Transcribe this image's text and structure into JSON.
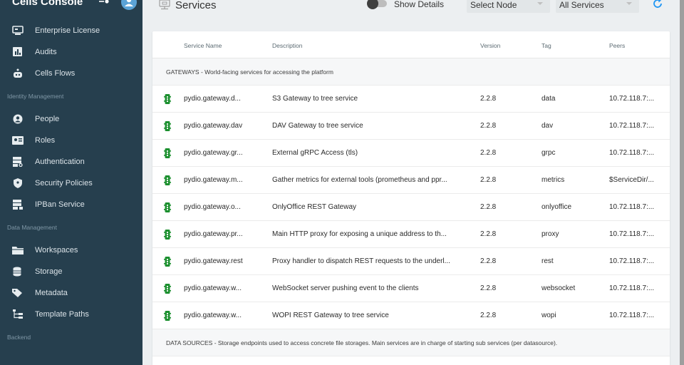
{
  "app": {
    "title": "Cells Console"
  },
  "colors": {
    "sidebar_bg": "#263f4e",
    "accent": "#5ba3d6",
    "status_ok": "#1b8f2e"
  },
  "sidebar": {
    "items_top": [
      {
        "label": "Enterprise License",
        "icon": "license-icon"
      },
      {
        "label": "Audits",
        "icon": "chart-icon"
      },
      {
        "label": "Cells Flows",
        "icon": "robot-icon"
      }
    ],
    "section_identity": "Identity Management",
    "items_identity": [
      {
        "label": "People",
        "icon": "person-icon"
      },
      {
        "label": "Roles",
        "icon": "id-card-icon"
      },
      {
        "label": "Authentication",
        "icon": "server-key-icon"
      },
      {
        "label": "Security Policies",
        "icon": "shield-icon"
      },
      {
        "label": "IPBan Service",
        "icon": "server-lock-icon"
      }
    ],
    "section_data": "Data Management",
    "items_data": [
      {
        "label": "Workspaces",
        "icon": "folder-icon"
      },
      {
        "label": "Storage",
        "icon": "database-icon"
      },
      {
        "label": "Metadata",
        "icon": "tag-icon"
      },
      {
        "label": "Template Paths",
        "icon": "file-tree-icon"
      }
    ],
    "section_backend": "Backend"
  },
  "header": {
    "title": "Services",
    "show_details_label": "Show Details",
    "select_node": "Select Node",
    "select_services": "All Services"
  },
  "table": {
    "columns": [
      "Service Name",
      "Description",
      "Version",
      "Tag",
      "Peers"
    ],
    "group_gateways": "GATEWAYS - World-facing services for accessing the platform",
    "rows": [
      {
        "name": "pydio.gateway.d...",
        "desc": "S3 Gateway to tree service",
        "version": "2.2.8",
        "tag": "data",
        "peers": "10.72.118.7:..."
      },
      {
        "name": "pydio.gateway.dav",
        "desc": "DAV Gateway to tree service",
        "version": "2.2.8",
        "tag": "dav",
        "peers": "10.72.118.7:..."
      },
      {
        "name": "pydio.gateway.gr...",
        "desc": "External gRPC Access (tls)",
        "version": "2.2.8",
        "tag": "grpc",
        "peers": "10.72.118.7:..."
      },
      {
        "name": "pydio.gateway.m...",
        "desc": "Gather metrics for external tools (prometheus and ppr...",
        "version": "2.2.8",
        "tag": "metrics",
        "peers": "$ServiceDir/..."
      },
      {
        "name": "pydio.gateway.o...",
        "desc": "OnlyOffice REST Gateway",
        "version": "2.2.8",
        "tag": "onlyoffice",
        "peers": "10.72.118.7:..."
      },
      {
        "name": "pydio.gateway.pr...",
        "desc": "Main HTTP proxy for exposing a unique address to th...",
        "version": "2.2.8",
        "tag": "proxy",
        "peers": "10.72.118.7:..."
      },
      {
        "name": "pydio.gateway.rest",
        "desc": "Proxy handler to dispatch REST requests to the underl...",
        "version": "2.2.8",
        "tag": "rest",
        "peers": "10.72.118.7:..."
      },
      {
        "name": "pydio.gateway.w...",
        "desc": "WebSocket server pushing event to the clients",
        "version": "2.2.8",
        "tag": "websocket",
        "peers": "10.72.118.7:..."
      },
      {
        "name": "pydio.gateway.w...",
        "desc": "WOPI REST Gateway to tree service",
        "version": "2.2.8",
        "tag": "wopi",
        "peers": "10.72.118.7:..."
      }
    ],
    "group_datasources": "DATA SOURCES - Storage endpoints used to access concrete file storages. Main services are in charge of starting sub services (per datasource)."
  }
}
